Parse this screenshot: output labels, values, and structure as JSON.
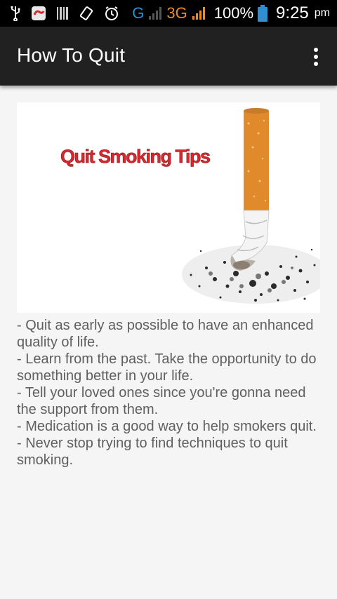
{
  "status_bar": {
    "network_g": "G",
    "network_3g": "3G",
    "battery": "100%",
    "time": "9:25",
    "ampm": "pm",
    "icons": [
      "usb-icon",
      "app-notification-icon",
      "barcode-icon",
      "rotate-icon",
      "alarm-icon",
      "signal-icon",
      "battery-icon"
    ]
  },
  "app_bar": {
    "title": "How To Quit"
  },
  "hero": {
    "caption": "Quit Smoking Tips"
  },
  "tips": [
    "- Quit as early as possible to have an enhanced quality of life.",
    "- Learn from the past. Take the opportunity to do something better in your life.",
    "- Tell your loved ones since you're gonna need the support from them.",
    "- Medication is a good way to help smokers quit.",
    "- Never stop trying to find techniques to quit smoking."
  ],
  "colors": {
    "app_bar": "#212121",
    "status_bar": "#000000",
    "background": "#f5f5f5",
    "caption_red": "#d6282f",
    "text": "#5f5f5f"
  }
}
